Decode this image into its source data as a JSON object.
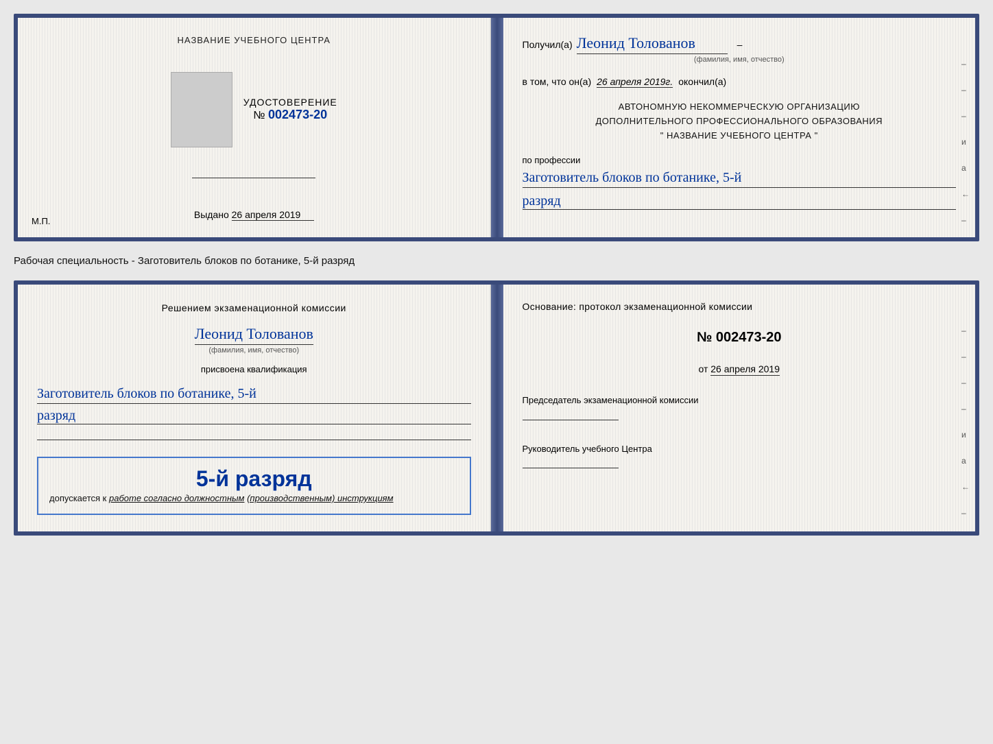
{
  "page": {
    "background": "#e8e8e8"
  },
  "top_doc": {
    "left": {
      "school_name": "НАЗВАНИЕ УЧЕБНОГО ЦЕНТРА",
      "cert_word": "УДОСТОВЕРЕНИЕ",
      "cert_no_label": "№",
      "cert_number": "002473-20",
      "issued_label": "Выдано",
      "issued_date": "26 апреля 2019",
      "mp_label": "М.П."
    },
    "right": {
      "received_prefix": "Получил(а)",
      "recipient_name": "Леонид Толованов",
      "fio_label": "(фамилия, имя, отчество)",
      "vtom_prefix": "в том, что он(а)",
      "vtom_date": "26 апреля 2019г.",
      "okonchil": "окончил(а)",
      "org_line1": "АВТОНОМНУЮ НЕКОММЕРЧЕСКУЮ ОРГАНИЗАЦИЮ",
      "org_line2": "ДОПОЛНИТЕЛЬНОГО ПРОФЕССИОНАЛЬНОГО ОБРАЗОВАНИЯ",
      "org_quote1": "\"",
      "org_name": "НАЗВАНИЕ УЧЕБНОГО ЦЕНТРА",
      "org_quote2": "\"",
      "profession_label": "по профессии",
      "profession_name": "Заготовитель блоков по ботанике, 5-й",
      "razryad": "разряд",
      "side_marks": [
        "-",
        "-",
        "-",
        "и",
        "а",
        "←",
        "-",
        "-",
        "-",
        "-",
        "-"
      ]
    }
  },
  "specialty_text": "Рабочая специальность - Заготовитель блоков по ботанике, 5-й разряд",
  "bottom_doc": {
    "left": {
      "decision_text": "Решением экзаменационной комиссии",
      "person_name": "Леонид Толованов",
      "fio_label": "(фамилия, имя, отчество)",
      "assigned_label": "присвоена квалификация",
      "qual_name": "Заготовитель блоков по ботанике, 5-й",
      "razryad": "разряд",
      "rank_big": "5-й разряд",
      "dopusk_prefix": "допускается к",
      "dopusk_text": "работе согласно должностным",
      "dopusk_text2": "(производственным) инструкциям"
    },
    "right": {
      "osnov_label": "Основание: протокол экзаменационной комиссии",
      "no_label": "№",
      "protocol_number": "002473-20",
      "ot_prefix": "от",
      "ot_date": "26 апреля 2019",
      "chairman_title": "Председатель экзаменационной комиссии",
      "director_title": "Руководитель учебного Центра",
      "side_marks": [
        "-",
        "-",
        "-",
        "-",
        "и",
        "а",
        "←",
        "-",
        "-",
        "-",
        "-",
        "-"
      ]
    }
  }
}
